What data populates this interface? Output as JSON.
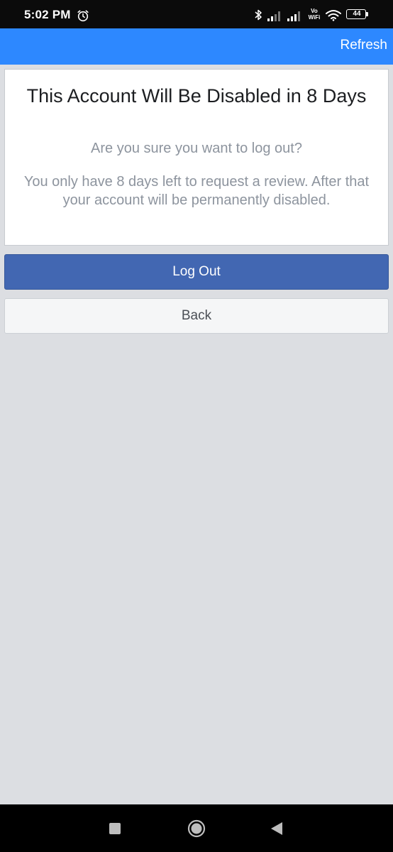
{
  "status_bar": {
    "time": "5:02 PM",
    "battery_level": "44",
    "vowifi_label_top": "Vo",
    "vowifi_label_bottom": "WiFi"
  },
  "header": {
    "refresh_label": "Refresh",
    "accent_color": "#2d88ff"
  },
  "card": {
    "title": "This Account Will Be Disabled in 8 Days",
    "question": "Are you sure you want to log out?",
    "warning": "You only have 8 days left to request a review. After that your account will be permanently disabled."
  },
  "buttons": {
    "logout_label": "Log Out",
    "logout_color": "#4267b2",
    "back_label": "Back"
  },
  "navigation": {
    "icons": [
      "recents-icon",
      "home-icon",
      "back-icon"
    ]
  }
}
